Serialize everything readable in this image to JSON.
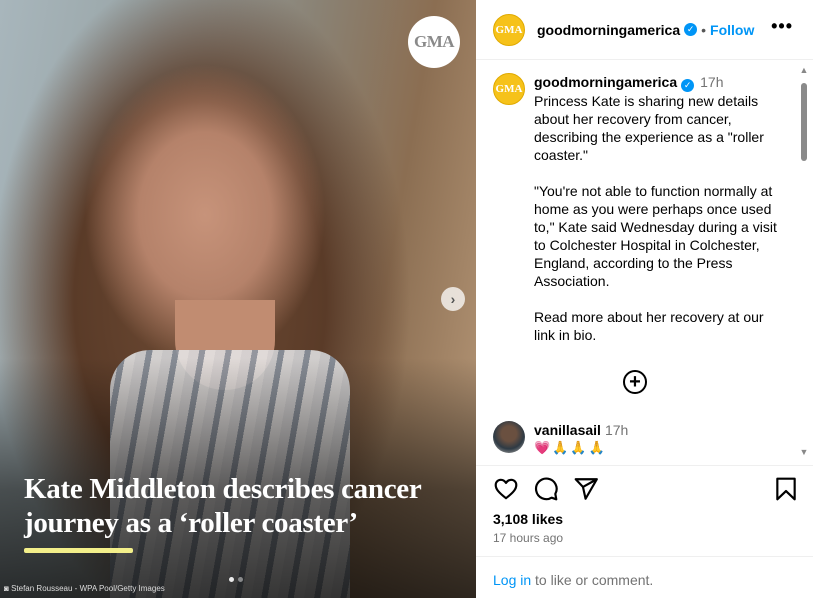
{
  "post": {
    "badge_text": "GMA",
    "headline": "Kate Middleton describes cancer journey as a ‘roller coaster’",
    "photo_credit": "Stefan Rousseau - WPA Pool/Getty Images",
    "next_icon": "chevron-right-icon",
    "slide_dots": 2
  },
  "header": {
    "avatar_text": "GMA",
    "username": "goodmorningamerica",
    "separator": "•",
    "follow_label": "Follow",
    "more_label": "•••"
  },
  "caption": {
    "avatar_text": "GMA",
    "username": "goodmorningamerica",
    "time": "17h",
    "paragraph1": "Princess Kate is sharing new details about her recovery from cancer, describing the experience as a \"roller coaster.\"",
    "paragraph2": "\"You're not able to function normally at home as you were perhaps once used to,\" Kate said Wednesday during a visit to Colchester Hospital in Colchester, England, according to the Press Association.",
    "paragraph3": "Read more about her recovery at our link in bio."
  },
  "load_more_icon": "plus-circle-icon",
  "comment": {
    "username": "vanillasail",
    "time": "17h",
    "emojis": "💗🙏🙏🙏"
  },
  "actions": {
    "like_icon": "heart-icon",
    "comment_icon": "comment-icon",
    "share_icon": "send-icon",
    "save_icon": "bookmark-icon"
  },
  "likes": "3,108 likes",
  "timestamp": "17 hours ago",
  "login": {
    "link_label": "Log in",
    "suffix": " to like or comment."
  },
  "colors": {
    "accent_blue": "#0095f6",
    "gma_yellow": "#f6c21a",
    "headline_underline": "#f3ef8a"
  }
}
